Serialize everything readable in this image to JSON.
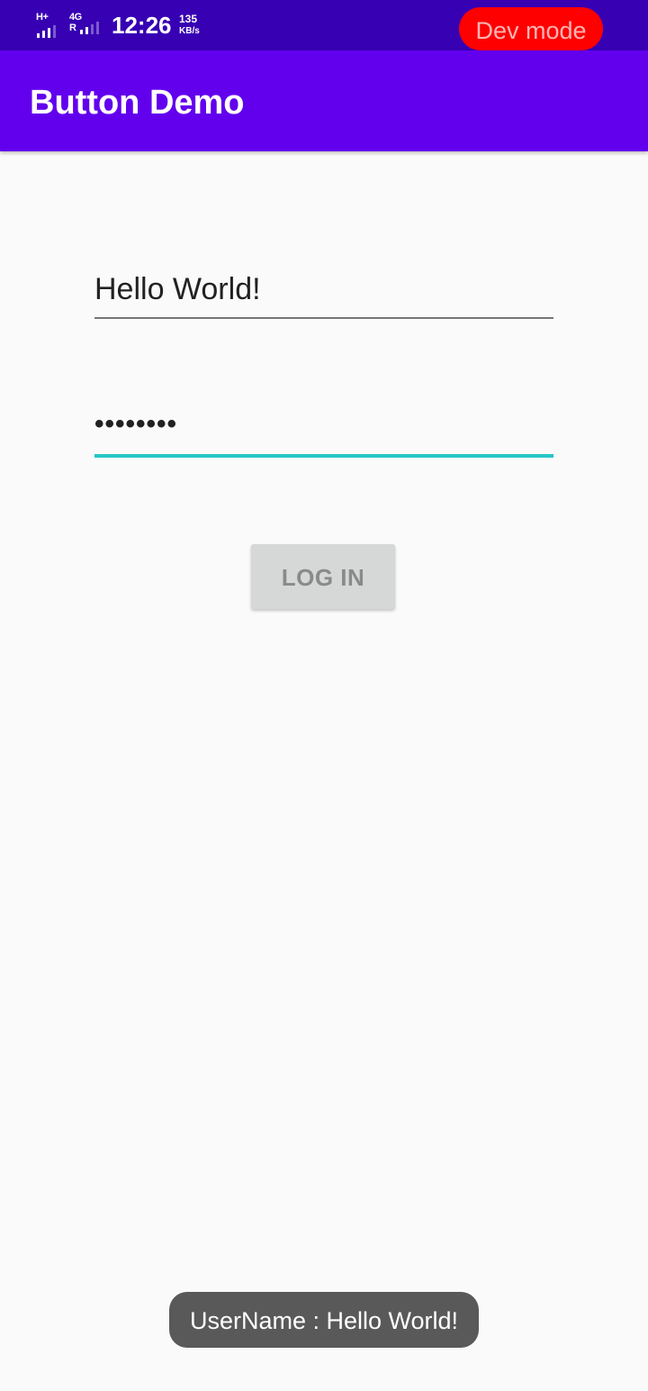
{
  "status_bar": {
    "network_top": "H+",
    "network_mid": "4G",
    "network_roam": "R",
    "time": "12:26",
    "speed_value": "135",
    "speed_unit": "KB/s",
    "dev_mode_label": "Dev mode",
    "colors": {
      "background": "#3700b3",
      "dev_pill": "#ff0000"
    }
  },
  "app_bar": {
    "title": "Button Demo",
    "color": "#6200ee"
  },
  "form": {
    "username_value": "Hello World!",
    "password_value": "••••••••",
    "focus_color": "#26c6c6",
    "login_label": "LOG IN"
  },
  "toast": {
    "message": "UserName : Hello World!"
  }
}
